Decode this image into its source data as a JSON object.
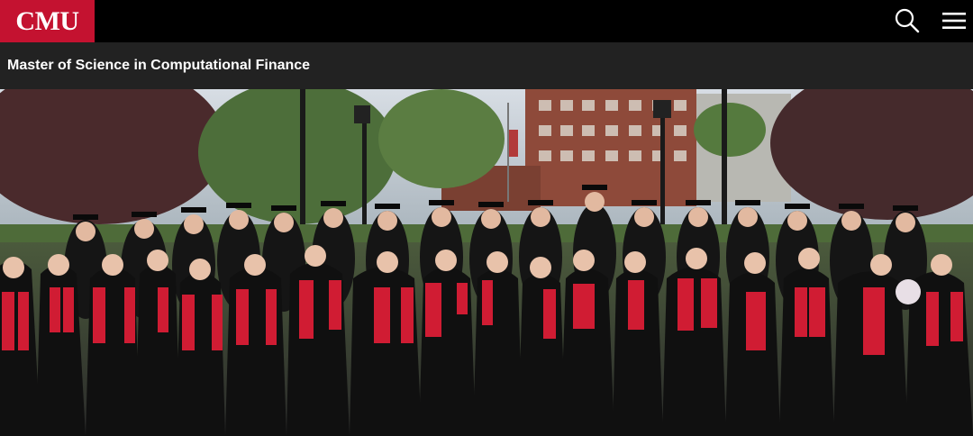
{
  "header": {
    "logo_text": "CMU",
    "brand_color": "#c41230",
    "search_icon": "search-icon",
    "menu_icon": "hamburger-menu-icon"
  },
  "subheader": {
    "title": "Master of Science in Computational Finance"
  },
  "hero": {
    "description_icon": "photo",
    "sash_color": "#d01c33",
    "gown_color": "#111111"
  }
}
